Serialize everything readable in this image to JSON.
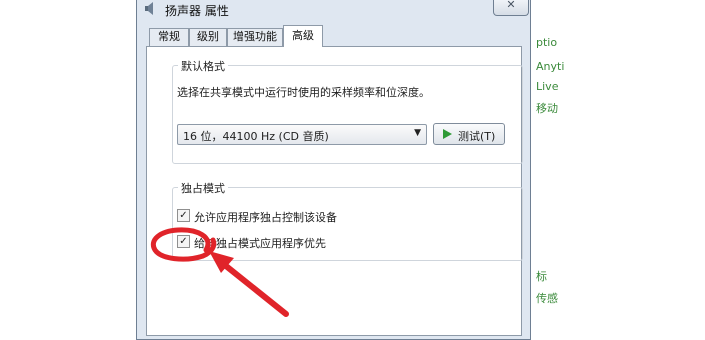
{
  "window": {
    "title": "扬声器 属性",
    "close_glyph": "✕",
    "tabs": [
      {
        "label": "常规",
        "active": false
      },
      {
        "label": "级别",
        "active": false
      },
      {
        "label": "增强功能",
        "active": false
      },
      {
        "label": "高级",
        "active": true
      }
    ]
  },
  "default_format": {
    "title": "默认格式",
    "description": "选择在共享模式中运行时使用的采样频率和位深度。",
    "selected": "16 位，44100 Hz (CD 音质)",
    "test_button": "测试(T)"
  },
  "exclusive_mode": {
    "title": "独占模式",
    "options": [
      {
        "label": "允许应用程序独占控制该设备",
        "checked": true,
        "check_glyph": "✓"
      },
      {
        "label": "给与独占模式应用程序优先",
        "checked": true,
        "check_glyph": "✓"
      }
    ]
  },
  "background_fragments": [
    "ptio",
    "Anyti",
    "Live",
    "移动",
    "标",
    "传感"
  ],
  "colors": {
    "accent": "#3a8a3a",
    "annotation": "#e0242a",
    "play": "#2e9a36"
  }
}
